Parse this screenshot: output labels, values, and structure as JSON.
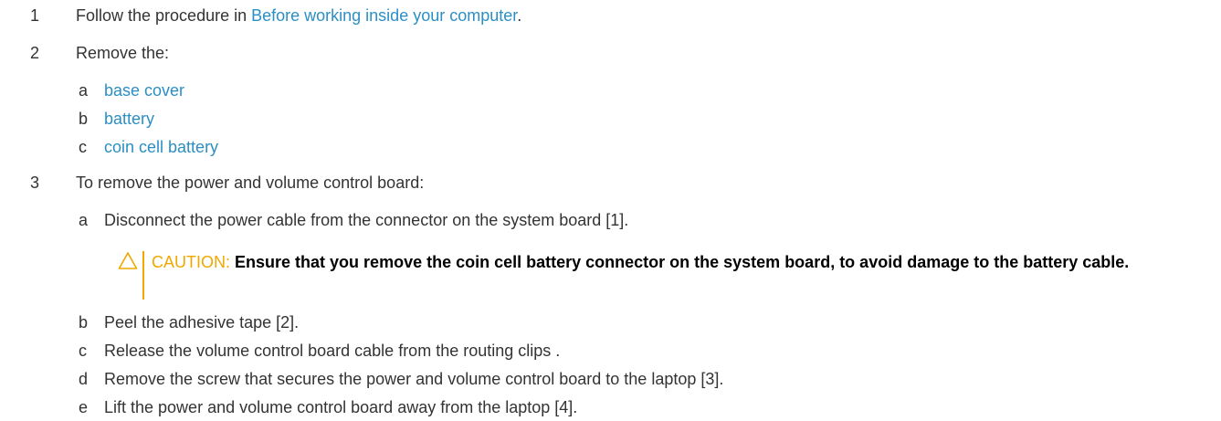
{
  "steps": [
    {
      "num": "1",
      "pre": "Follow the procedure in ",
      "link": "Before working inside your computer",
      "post": "."
    },
    {
      "num": "2",
      "text": "Remove the:",
      "sub": [
        {
          "letter": "a",
          "link": "base cover"
        },
        {
          "letter": "b",
          "link": "battery"
        },
        {
          "letter": "c",
          "link": "coin cell battery"
        }
      ]
    },
    {
      "num": "3",
      "text": "To remove the power and volume control board:",
      "sub": [
        {
          "letter": "a",
          "text": "Disconnect the power cable from the connector on the system board [1]."
        },
        {
          "letter": "b",
          "text": "Peel the adhesive tape [2]."
        },
        {
          "letter": "c",
          "text": "Release the volume control board cable from the routing clips ."
        },
        {
          "letter": "d",
          "text": "Remove the screw that secures the power and volume control board to the laptop [3]."
        },
        {
          "letter": "e",
          "text": "Lift the power and volume control board away from the laptop [4]."
        }
      ]
    }
  ],
  "caution": {
    "icon": "warning-triangle-icon",
    "label": "CAUTION:",
    "text": "Ensure that you remove the coin cell battery connector on the system board, to avoid damage to the battery cable."
  },
  "colors": {
    "link": "#2b8fc4",
    "caution": "#f0a800",
    "text": "#333333"
  }
}
